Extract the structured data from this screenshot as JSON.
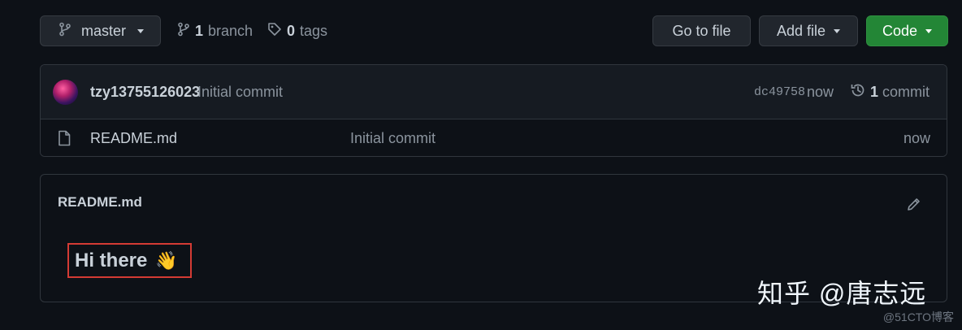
{
  "toolbar": {
    "branch_selector": "master",
    "branches_count": "1",
    "branches_label": "branch",
    "tags_count": "0",
    "tags_label": "tags",
    "go_to_file": "Go to file",
    "add_file": "Add file",
    "code": "Code"
  },
  "latest_commit": {
    "author": "tzy13755126023",
    "message": "Initial commit",
    "sha": "dc49758",
    "time": "now",
    "commit_count": "1",
    "commit_label": "commit"
  },
  "files": [
    {
      "name": "README.md",
      "last_commit": "Initial commit",
      "age": "now",
      "icon": "file-icon"
    }
  ],
  "readme": {
    "title": "README.md",
    "heading": "Hi there",
    "heading_emoji": "👋"
  },
  "watermarks": {
    "zhihu": "知乎 @唐志远",
    "cto": "@51CTO博客"
  },
  "colors": {
    "background": "#0d1117",
    "button_bg": "#21262d",
    "code_button_bg": "#238636",
    "highlight_border": "#d43b34"
  }
}
